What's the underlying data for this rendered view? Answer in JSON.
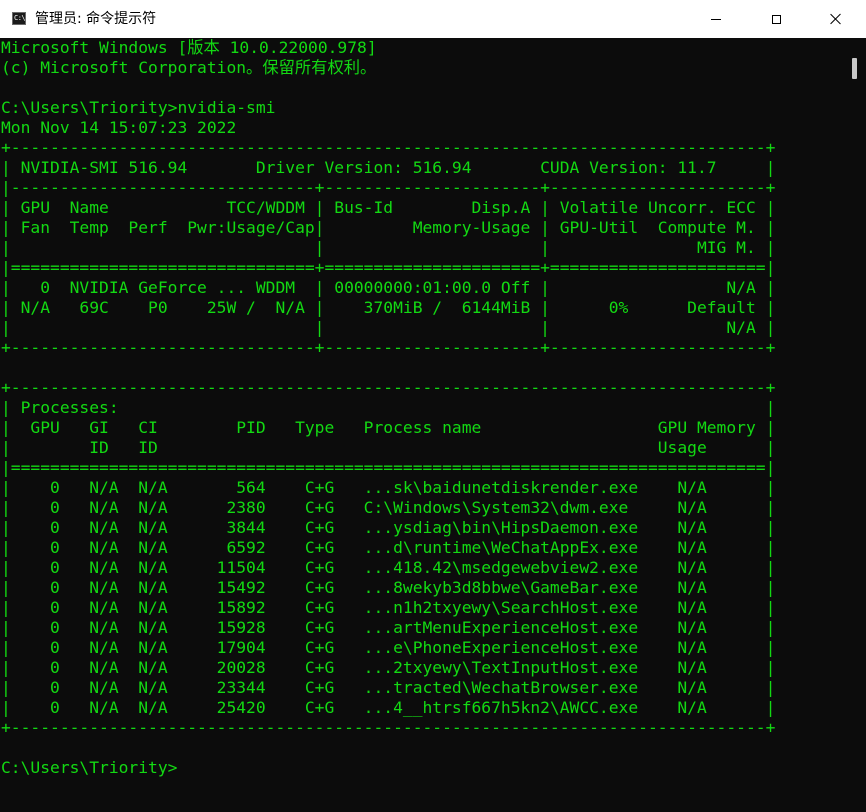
{
  "window": {
    "title": "管理员: 命令提示符",
    "icon_name": "cmd-icon",
    "icon_glyph": "C:\\."
  },
  "controls": {
    "minimize_icon": "minimize-icon",
    "maximize_icon": "maximize-icon",
    "close_icon": "close-icon"
  },
  "colors": {
    "console_background": "#0c0c0c",
    "console_text": "#13d913",
    "titlebar_background": "#ffffff"
  },
  "console": {
    "lines": [
      "Microsoft Windows [版本 10.0.22000.978]",
      "(c) Microsoft Corporation。保留所有权利。",
      "",
      "C:\\Users\\Triority>nvidia-smi",
      "Mon Nov 14 15:07:23 2022",
      "+-----------------------------------------------------------------------------+",
      "| NVIDIA-SMI 516.94       Driver Version: 516.94       CUDA Version: 11.7     |",
      "|-------------------------------+----------------------+----------------------+",
      "| GPU  Name            TCC/WDDM | Bus-Id        Disp.A | Volatile Uncorr. ECC |",
      "| Fan  Temp  Perf  Pwr:Usage/Cap|         Memory-Usage | GPU-Util  Compute M. |",
      "|                               |                      |               MIG M. |",
      "|===============================+======================+======================|",
      "|   0  NVIDIA GeForce ... WDDM  | 00000000:01:00.0 Off |                  N/A |",
      "| N/A   69C    P0    25W /  N/A |    370MiB /  6144MiB |      0%      Default |",
      "|                               |                      |                  N/A |",
      "+-------------------------------+----------------------+----------------------+",
      "",
      "+-----------------------------------------------------------------------------+",
      "| Processes:                                                                  |",
      "|  GPU   GI   CI        PID   Type   Process name                  GPU Memory |",
      "|        ID   ID                                                   Usage      |",
      "|=============================================================================|",
      "|    0   N/A  N/A       564    C+G   ...sk\\baidunetdiskrender.exe    N/A      |",
      "|    0   N/A  N/A      2380    C+G   C:\\Windows\\System32\\dwm.exe     N/A      |",
      "|    0   N/A  N/A      3844    C+G   ...ysdiag\\bin\\HipsDaemon.exe    N/A      |",
      "|    0   N/A  N/A      6592    C+G   ...d\\runtime\\WeChatAppEx.exe    N/A      |",
      "|    0   N/A  N/A     11504    C+G   ...418.42\\msedgewebview2.exe    N/A      |",
      "|    0   N/A  N/A     15492    C+G   ...8wekyb3d8bbwe\\GameBar.exe    N/A      |",
      "|    0   N/A  N/A     15892    C+G   ...n1h2txyewy\\SearchHost.exe    N/A      |",
      "|    0   N/A  N/A     15928    C+G   ...artMenuExperienceHost.exe    N/A      |",
      "|    0   N/A  N/A     17904    C+G   ...e\\PhoneExperienceHost.exe    N/A      |",
      "|    0   N/A  N/A     20028    C+G   ...2txyewy\\TextInputHost.exe    N/A      |",
      "|    0   N/A  N/A     23344    C+G   ...tracted\\WechatBrowser.exe    N/A      |",
      "|    0   N/A  N/A     25420    C+G   ...4__htrsf667h5kn2\\AWCC.exe    N/A      |",
      "+-----------------------------------------------------------------------------+",
      "",
      "C:\\Users\\Triority>"
    ]
  }
}
